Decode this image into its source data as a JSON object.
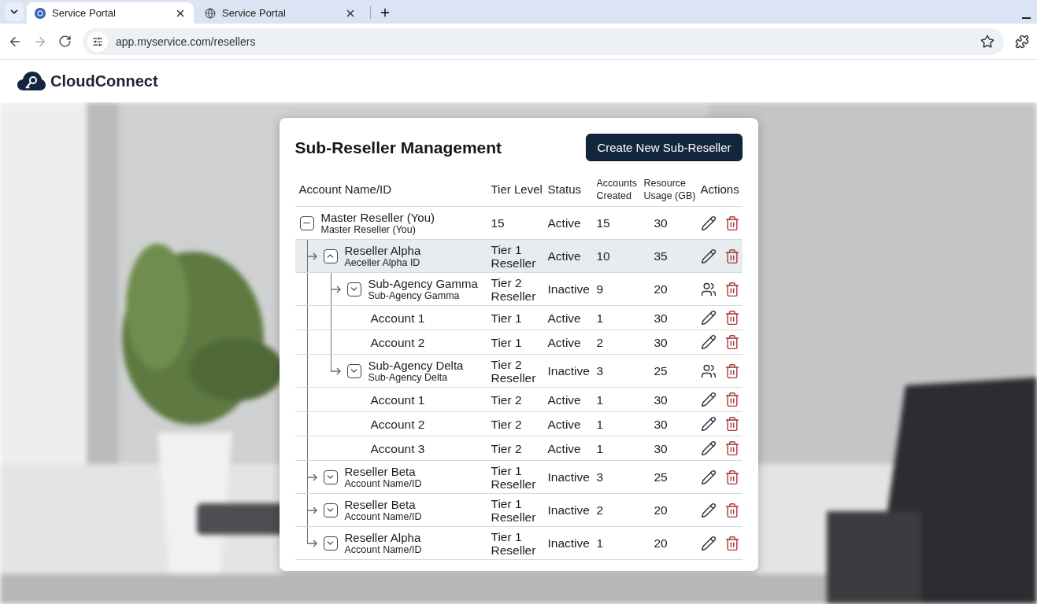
{
  "browser": {
    "tabs": [
      {
        "title": "Service Portal",
        "selected": true
      },
      {
        "title": "Service Portal",
        "selected": false
      }
    ],
    "address": "app.myservice.com/resellers"
  },
  "app": {
    "brand": "CloudConnect"
  },
  "panel": {
    "title": "Sub-Reseller Management",
    "create_button": "Create New Sub-Reseller",
    "columns": [
      "Account Name/ID",
      "Tier Level",
      "Status",
      "Accounts Created",
      "Resource Usage (GB)",
      "Actions"
    ],
    "rows": [
      {
        "kind": "reseller",
        "name": "Master Reseller (You)",
        "id": "Master Reseller (You)",
        "tier": "15",
        "status": "Active",
        "accounts": "15",
        "usage": "30",
        "manage_users": false,
        "expanded": true,
        "selected": false,
        "children": [
          {
            "kind": "reseller",
            "name": "Reseller Alpha",
            "id": "Aeceller Alpha ID",
            "tier": "Tier 1 Reseller",
            "status": "Active",
            "accounts": "10",
            "usage": "35",
            "manage_users": false,
            "expanded": true,
            "selected": true,
            "children": [
              {
                "kind": "reseller",
                "name": "Sub-Agency Gamma",
                "id": "Sub-Agency Gamma",
                "tier": "Tier 2 Reseller",
                "status": "Inactive",
                "accounts": "9",
                "usage": "20",
                "manage_users": true,
                "expanded": false,
                "selected": false,
                "children": [
                  {
                    "kind": "account",
                    "name": "Account 1",
                    "tier": "Tier 1",
                    "status": "Active",
                    "accounts": "1",
                    "usage": "30",
                    "manage_users": false,
                    "selected": false
                  },
                  {
                    "kind": "account",
                    "name": "Account 2",
                    "tier": "Tier 1",
                    "status": "Active",
                    "accounts": "2",
                    "usage": "30",
                    "manage_users": false,
                    "selected": false
                  }
                ]
              },
              {
                "kind": "reseller",
                "name": "Sub-Agency Delta",
                "id": "Sub-Agency Delta",
                "tier": "Tier 2 Reseller",
                "status": "Inactive",
                "accounts": "3",
                "usage": "25",
                "manage_users": true,
                "expanded": false,
                "selected": false,
                "children": [
                  {
                    "kind": "account",
                    "name": "Account 1",
                    "tier": "Tier 2",
                    "status": "Active",
                    "accounts": "1",
                    "usage": "30",
                    "manage_users": false,
                    "selected": false
                  },
                  {
                    "kind": "account",
                    "name": "Account 2",
                    "tier": "Tier 2",
                    "status": "Active",
                    "accounts": "1",
                    "usage": "30",
                    "manage_users": false,
                    "selected": false
                  },
                  {
                    "kind": "account",
                    "name": "Account 3",
                    "tier": "Tier 2",
                    "status": "Active",
                    "accounts": "1",
                    "usage": "30",
                    "manage_users": false,
                    "selected": false
                  }
                ]
              }
            ]
          },
          {
            "kind": "reseller",
            "name": "Reseller Beta",
            "id": "Account Name/ID",
            "tier": "Tier 1 Reseller",
            "status": "Inactive",
            "accounts": "3",
            "usage": "25",
            "manage_users": false,
            "expanded": false,
            "selected": false
          },
          {
            "kind": "reseller",
            "name": "Reseller Beta",
            "id": "Account Name/ID",
            "tier": "Tier 1 Reseller",
            "status": "Inactive",
            "accounts": "2",
            "usage": "20",
            "manage_users": false,
            "expanded": false,
            "selected": false
          },
          {
            "kind": "reseller",
            "name": "Reseller Alpha",
            "id": "Account Name/ID",
            "tier": "Tier 1 Reseller",
            "status": "Inactive",
            "accounts": "1",
            "usage": "20",
            "manage_users": false,
            "expanded": false,
            "selected": false
          }
        ]
      }
    ]
  }
}
